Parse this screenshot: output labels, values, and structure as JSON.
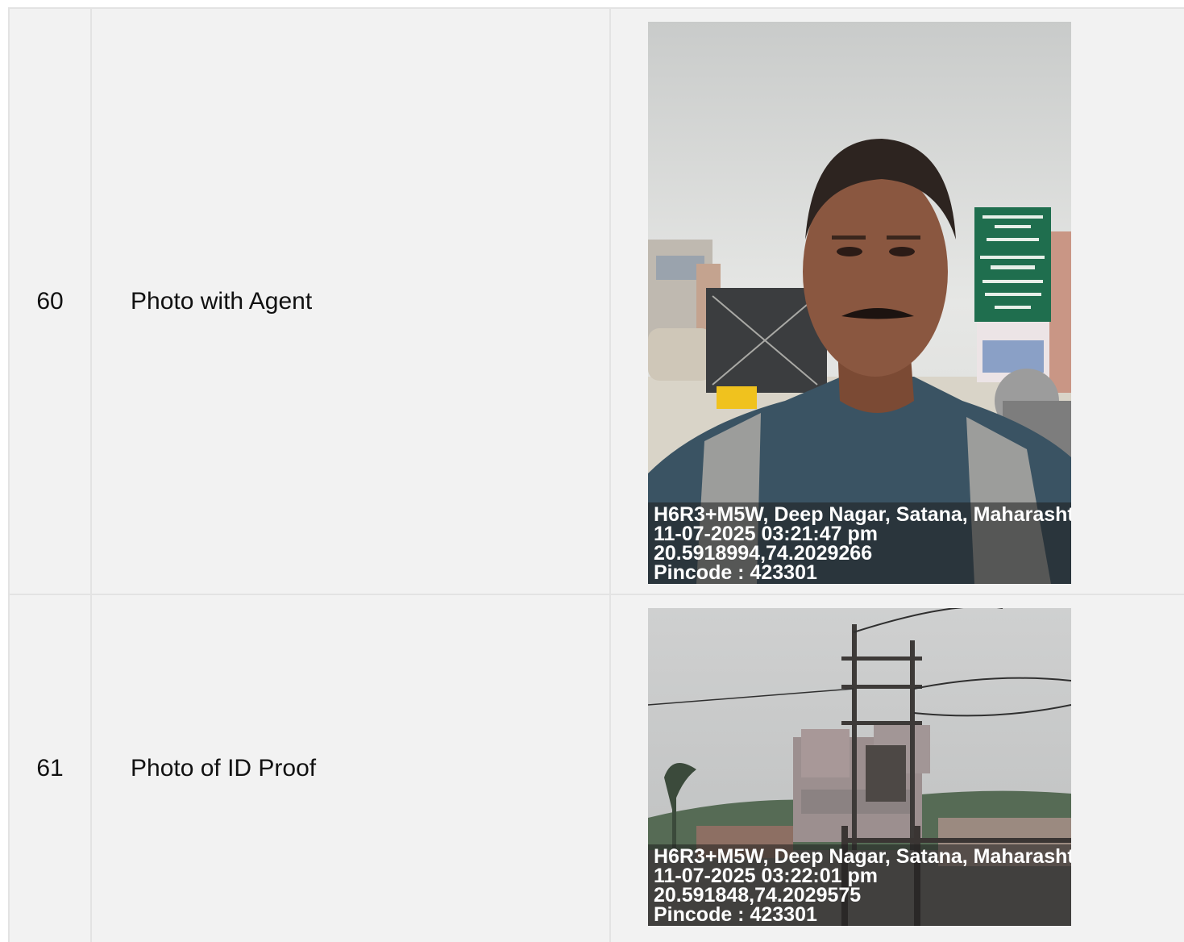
{
  "rows": [
    {
      "number": "60",
      "label": "Photo with Agent",
      "photo": {
        "description_icon": "selfie-photo",
        "stamp": {
          "address": "H6R3+M5W, Deep Nagar, Satana, Maharasht",
          "datetime": "11-07-2025 03:21:47 pm",
          "coords": "20.5918994,74.2029266",
          "pincode": "Pincode : 423301"
        }
      }
    },
    {
      "number": "61",
      "label": "Photo of ID Proof",
      "photo": {
        "description_icon": "street-photo",
        "stamp": {
          "address": "H6R3+M5W, Deep Nagar, Satana, Maharasht",
          "datetime": "11-07-2025 03:22:01 pm",
          "coords": "20.591848,74.2029575",
          "pincode": "Pincode : 423301"
        }
      }
    }
  ],
  "colors": {
    "row_bg": "#f2f2f2",
    "border": "#e3e3e3",
    "stamp_text": "#ffffff"
  }
}
